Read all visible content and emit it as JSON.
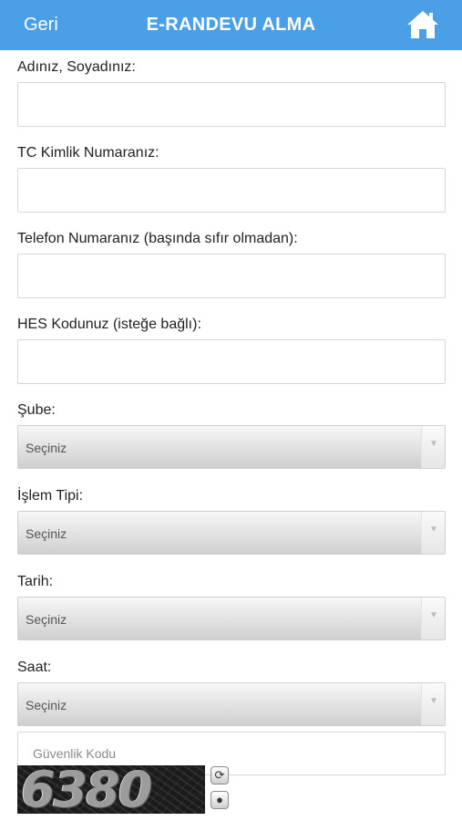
{
  "header": {
    "back_label": "Geri",
    "title": "E-RANDEVU ALMA",
    "home_icon": "home-icon",
    "bg_color": "#4a9fe6"
  },
  "form": {
    "name_label": "Adınız, Soyadınız:",
    "name_value": "",
    "tc_label": "TC Kimlik Numaranız:",
    "tc_value": "",
    "phone_label": "Telefon Numaranız (başında sıfır olmadan):",
    "phone_value": "",
    "hes_label": "HES Kodunuz (isteğe bağlı):",
    "hes_value": "",
    "branch_label": "Şube:",
    "branch_value": "Seçiniz",
    "process_label": "İşlem Tipi:",
    "process_value": "Seçiniz",
    "date_label": "Tarih:",
    "date_value": "Seçiniz",
    "time_label": "Saat:",
    "time_value": "Seçiniz",
    "captcha_placeholder": "Güvenlik Kodu"
  },
  "captcha": {
    "code": "6380",
    "refresh_icon": "refresh-icon",
    "audio_icon": "audio-icon"
  }
}
